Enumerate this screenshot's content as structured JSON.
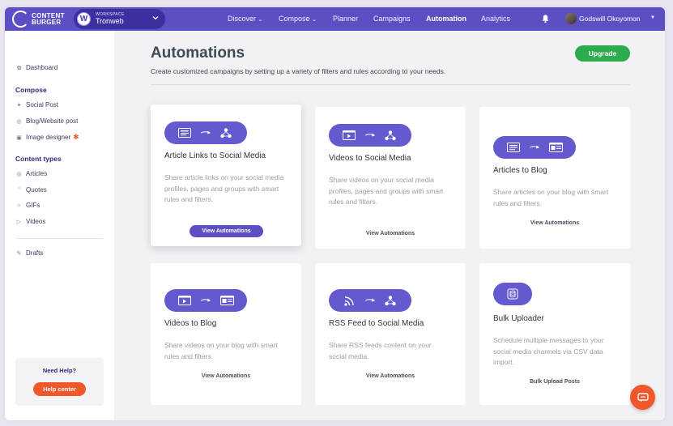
{
  "app": {
    "logo_line1": "CONTENT",
    "logo_line2": "BURGER",
    "workspace_caption": "WORKSPACE",
    "workspace_name": "Tronweb",
    "workspace_initial": "W"
  },
  "nav": {
    "items": [
      {
        "label": "Discover",
        "has_caret": true
      },
      {
        "label": "Compose",
        "has_caret": true
      },
      {
        "label": "Planner"
      },
      {
        "label": "Campaigns"
      },
      {
        "label": "Automation",
        "active": true
      },
      {
        "label": "Analytics"
      }
    ],
    "user_name": "Godswill Okoyomon"
  },
  "sidebar": {
    "dashboard": "Dashboard",
    "compose_heading": "Compose",
    "compose_items": [
      "Social Post",
      "Blog/Website post",
      "Image designer"
    ],
    "content_heading": "Content types",
    "content_items": [
      "Articles",
      "Quotes",
      "GIFs",
      "Videos"
    ],
    "drafts": "Drafts",
    "help_title": "Need Help?",
    "help_button": "Help center"
  },
  "page": {
    "title": "Automations",
    "subtitle": "Create customized campaigns by setting up a variety of filters and rules according to your needs.",
    "upgrade_label": "Upgrade"
  },
  "cards": [
    {
      "title": "Article Links to Social Media",
      "description": "Share article links on your social media profiles, pages and groups with smart rules and filters.",
      "action": "View Automations"
    },
    {
      "title": "Videos to Social Media",
      "description": "Share videos on your social media profiles, pages and groups with smart rules and filters.",
      "action": "View Automations"
    },
    {
      "title": "Articles to Blog",
      "description": "Share articles on your blog with smart rules and filters.",
      "action": "View Automations"
    },
    {
      "title": "Videos to Blog",
      "description": "Share videos on your blog with smart rules and filters.",
      "action": "View Automations"
    },
    {
      "title": "RSS Feed to Social Media",
      "description": "Share RSS feeds content on your social media.",
      "action": "View Automations"
    },
    {
      "title": "Bulk Uploader",
      "description": "Schedule multiple messages to your social media channels via CSV data import.",
      "action": "Bulk Upload Posts"
    }
  ],
  "colors": {
    "brand": "#5c4fc4",
    "upgrade": "#2eaa4f",
    "accent_orange": "#f0582c"
  }
}
